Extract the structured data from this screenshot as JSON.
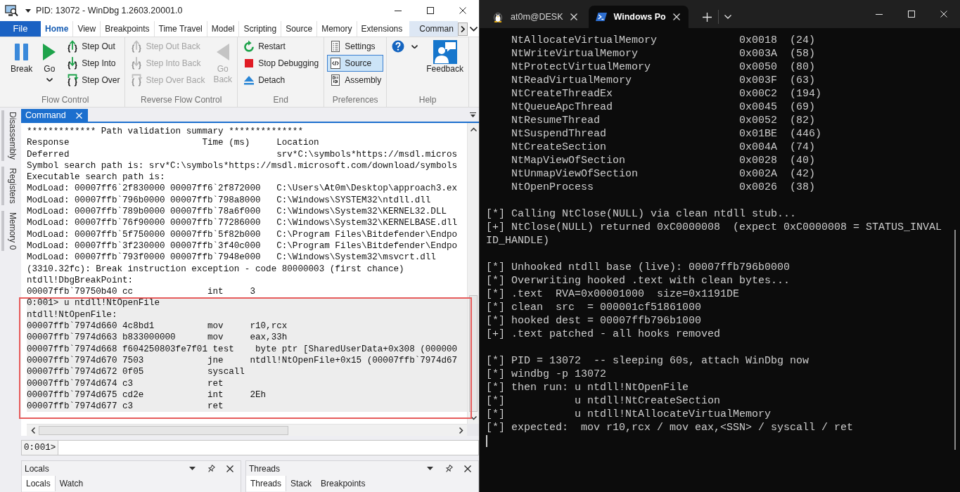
{
  "windbg": {
    "title_bar": {
      "title": "PID: 13072 - WinDbg 1.2603.20001.0"
    },
    "ribbon_tabs": [
      {
        "label": "File",
        "kind": "file",
        "selected": false
      },
      {
        "label": "Home",
        "kind": "tab",
        "selected": true
      },
      {
        "label": "View",
        "kind": "tab",
        "selected": false
      },
      {
        "label": "Breakpoints",
        "kind": "tab",
        "selected": false
      },
      {
        "label": "Time Travel",
        "kind": "tab",
        "selected": false
      },
      {
        "label": "Model",
        "kind": "tab",
        "selected": false
      },
      {
        "label": "Scripting",
        "kind": "tab",
        "selected": false
      },
      {
        "label": "Source",
        "kind": "tab",
        "selected": false
      },
      {
        "label": "Memory",
        "kind": "tab",
        "selected": false
      },
      {
        "label": "Extensions",
        "kind": "tab",
        "selected": false
      },
      {
        "label": "Comman",
        "kind": "contextual",
        "selected": false
      }
    ],
    "ribbon_groups": [
      {
        "label": "Flow Control",
        "items": [
          {
            "kind": "large",
            "label": "Break",
            "disabled": false,
            "checked": false,
            "dropdown": false
          },
          {
            "kind": "large",
            "label": "Go",
            "disabled": false,
            "checked": false,
            "dropdown": true
          },
          {
            "kind": "small",
            "label": "Step Out",
            "disabled": false,
            "checked": false,
            "dropdown": false
          },
          {
            "kind": "small",
            "label": "Step Into",
            "disabled": false,
            "checked": false,
            "dropdown": false
          },
          {
            "kind": "small",
            "label": "Step Over",
            "disabled": false,
            "checked": false,
            "dropdown": false
          }
        ]
      },
      {
        "label": "Reverse Flow Control",
        "items": [
          {
            "kind": "small",
            "label": "Step Out Back",
            "disabled": true,
            "checked": false,
            "dropdown": false
          },
          {
            "kind": "small",
            "label": "Step Into Back",
            "disabled": true,
            "checked": false,
            "dropdown": false
          },
          {
            "kind": "small",
            "label": "Step Over Back",
            "disabled": true,
            "checked": false,
            "dropdown": false
          },
          {
            "kind": "large",
            "label": "Go Back",
            "disabled": true,
            "checked": false,
            "dropdown": false
          }
        ]
      },
      {
        "label": "End",
        "items": [
          {
            "kind": "small",
            "label": "Restart",
            "disabled": false,
            "checked": false,
            "dropdown": false
          },
          {
            "kind": "small",
            "label": "Stop Debugging",
            "disabled": false,
            "checked": false,
            "dropdown": false
          },
          {
            "kind": "small",
            "label": "Detach",
            "disabled": false,
            "checked": false,
            "dropdown": false
          }
        ]
      },
      {
        "label": "Preferences",
        "items": [
          {
            "kind": "small",
            "label": "Settings",
            "disabled": false,
            "checked": false,
            "dropdown": false
          },
          {
            "kind": "small",
            "label": "Source",
            "disabled": false,
            "checked": true,
            "dropdown": false
          },
          {
            "kind": "small",
            "label": "Assembly",
            "disabled": false,
            "checked": false,
            "dropdown": false
          }
        ]
      },
      {
        "label": "Help",
        "items": [
          {
            "kind": "icon",
            "disabled": false,
            "checked": false,
            "dropdown": true
          },
          {
            "kind": "large",
            "label": "Feedback",
            "disabled": false,
            "checked": false,
            "dropdown": false
          }
        ]
      }
    ],
    "side_tabs": [
      "Disassembly",
      "Registers",
      "Memory 0"
    ],
    "command_window": {
      "tab": "Command",
      "output_blocks": [
        {
          "shaded": false,
          "outlined": false,
          "lines": [
            "************* Path validation summary **************",
            "Response                         Time (ms)     Location",
            "Deferred                                       srv*C:\\symbols*https://msdl.micros",
            "Symbol search path is: srv*C:\\symbols*https://msdl.microsoft.com/download/symbols",
            "Executable search path is:",
            "ModLoad: 00007ff6`2f830000 00007ff6`2f872000   C:\\Users\\At0m\\Desktop\\approach3.ex",
            "ModLoad: 00007ffb`796b0000 00007ffb`798a8000   C:\\Windows\\SYSTEM32\\ntdll.dll",
            "ModLoad: 00007ffb`789b0000 00007ffb`78a6f000   C:\\Windows\\System32\\KERNEL32.DLL",
            "ModLoad: 00007ffb`76f90000 00007ffb`77286000   C:\\Windows\\System32\\KERNELBASE.dll",
            "ModLoad: 00007ffb`5f750000 00007ffb`5f82b000   C:\\Program Files\\Bitdefender\\Endpo",
            "ModLoad: 00007ffb`3f230000 00007ffb`3f40c000   C:\\Program Files\\Bitdefender\\Endpo",
            "ModLoad: 00007ffb`793f0000 00007ffb`7948e000   C:\\Windows\\System32\\msvcrt.dll",
            "(3310.32fc): Break instruction exception - code 80000003 (first chance)",
            "ntdll!DbgBreakPoint:",
            "00007ffb`79750b40 cc              int     3"
          ]
        },
        {
          "shaded": true,
          "outlined": true,
          "lines": [
            "0:001> u ntdll!NtOpenFile",
            "ntdll!NtOpenFile:",
            "00007ffb`7974d660 4c8bd1          mov     r10,rcx",
            "00007ffb`7974d663 b833000000      mov     eax,33h",
            "00007ffb`7974d668 f604250803fe7f01 test    byte ptr [SharedUserData+0x308 (000000",
            "00007ffb`7974d670 7503            jne     ntdll!NtOpenFile+0x15 (00007ffb`7974d67",
            "00007ffb`7974d672 0f05            syscall",
            "00007ffb`7974d674 c3              ret",
            "00007ffb`7974d675 cd2e            int     2Eh",
            "00007ffb`7974d677 c3              ret"
          ]
        }
      ],
      "prompt": "0:001>"
    },
    "bottom_panels": [
      {
        "title": "Locals",
        "tabs": [
          {
            "label": "Locals",
            "selected": true
          },
          {
            "label": "Watch",
            "selected": false
          }
        ]
      },
      {
        "title": "Threads",
        "tabs": [
          {
            "label": "Threads",
            "selected": true
          },
          {
            "label": "Stack",
            "selected": false
          },
          {
            "label": "Breakpoints",
            "selected": false
          }
        ]
      }
    ]
  },
  "terminal": {
    "tabs": [
      {
        "label": "at0m@DESK",
        "selected": false
      },
      {
        "label": "Windows Po",
        "selected": true
      }
    ],
    "syscall_table": [
      [
        "NtAllocateVirtualMemory",
        "0x0018",
        "(24)"
      ],
      [
        "NtWriteVirtualMemory",
        "0x003A",
        "(58)"
      ],
      [
        "NtProtectVirtualMemory",
        "0x0050",
        "(80)"
      ],
      [
        "NtReadVirtualMemory",
        "0x003F",
        "(63)"
      ],
      [
        "NtCreateThreadEx",
        "0x00C2",
        "(194)"
      ],
      [
        "NtQueueApcThread",
        "0x0045",
        "(69)"
      ],
      [
        "NtResumeThread",
        "0x0052",
        "(82)"
      ],
      [
        "NtSuspendThread",
        "0x01BE",
        "(446)"
      ],
      [
        "NtCreateSection",
        "0x004A",
        "(74)"
      ],
      [
        "NtMapViewOfSection",
        "0x0028",
        "(40)"
      ],
      [
        "NtUnmapViewOfSection",
        "0x002A",
        "(42)"
      ],
      [
        "NtOpenProcess",
        "0x0026",
        "(38)"
      ]
    ],
    "output_blocks": [
      [
        "[*] Calling NtClose(NULL) via clean ntdll stub...",
        "[+] NtClose(NULL) returned 0xC0000008  (expect 0xC0000008 = STATUS_INVALID_HANDLE)"
      ],
      [
        "[*] Unhooked ntdll base (live): 00007ffb796b0000",
        "[*] Overwriting hooked .text with clean bytes...",
        "[*] .text  RVA=0x00001000  size=0x1191DE",
        "[*] clean  src  = 000001cf51861000",
        "[*] hooked dest = 00007ffb796b1000",
        "[+] .text patched - all hooks removed"
      ],
      [
        "[*] PID = 13072  -- sleeping 60s, attach WinDbg now",
        "[*] windbg -p 13072",
        "[*] then run: u ntdll!NtOpenFile",
        "[*]           u ntdll!NtCreateSection",
        "[*]           u ntdll!NtAllocateVirtualMemory",
        "[*] expected:  mov r10,rcx / mov eax,<SSN> / syscall / ret"
      ]
    ]
  }
}
